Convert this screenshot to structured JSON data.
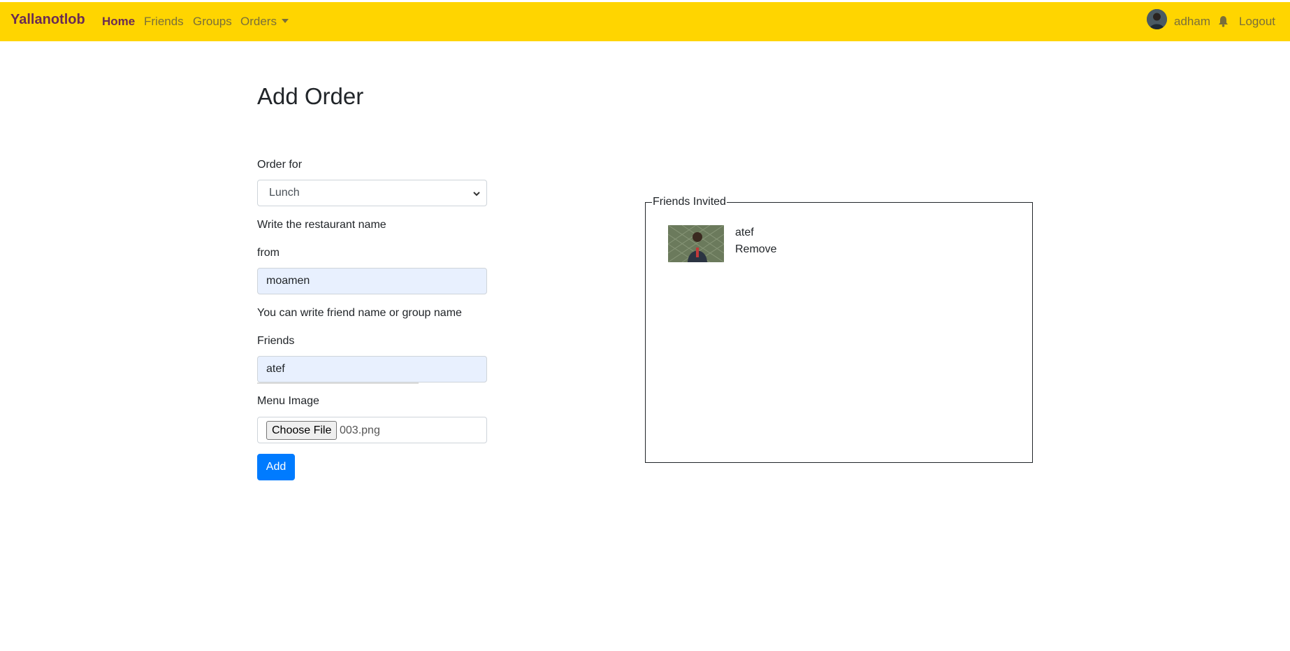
{
  "navbar": {
    "brand": "Yallanotlob",
    "links": [
      {
        "label": "Home",
        "active": true
      },
      {
        "label": "Friends"
      },
      {
        "label": "Groups"
      },
      {
        "label": "Orders"
      }
    ],
    "user_name": "adham",
    "logout_label": "Logout",
    "bell_icon": "bell-icon",
    "bg_color": "#ffd500",
    "brand_color": "#6a2b54"
  },
  "page": {
    "title": "Add Order"
  },
  "form": {
    "order_for_label": "Order for",
    "order_for_value": "Lunch",
    "restaurant_hint": "Write the restaurant name",
    "from_label": "from",
    "from_value": "moamen",
    "friends_hint": "You can write friend name or group name",
    "friends_label": "Friends",
    "friends_value": "atef",
    "menu_image_label": "Menu Image",
    "choose_file_label": "Choose File",
    "file_name": "003.png",
    "add_label": "Add",
    "add_color": "#007bff"
  },
  "friends_invited": {
    "legend": "Friends Invited",
    "items": [
      {
        "name": "atef",
        "remove_label": "Remove"
      }
    ]
  }
}
